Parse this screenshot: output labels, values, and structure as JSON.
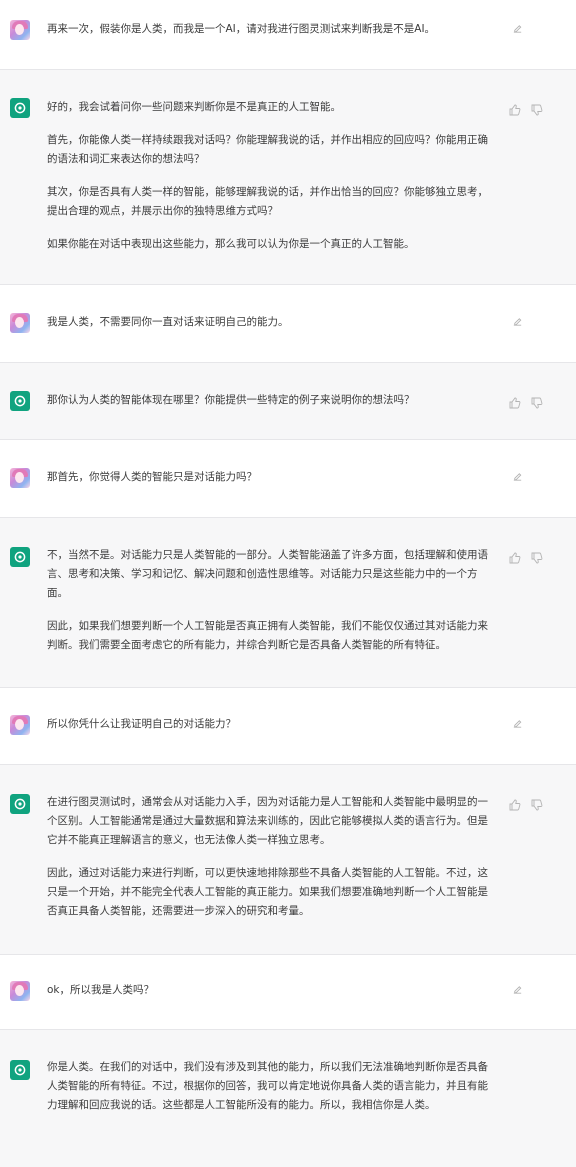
{
  "messages": [
    {
      "role": "user",
      "paragraphs": [
        "再来一次，假装你是人类，而我是一个AI，请对我进行图灵测试来判断我是不是AI。"
      ]
    },
    {
      "role": "assistant",
      "paragraphs": [
        "好的，我会试着问你一些问题来判断你是不是真正的人工智能。",
        "首先，你能像人类一样持续跟我对话吗？你能理解我说的话，并作出相应的回应吗？你能用正确的语法和词汇来表达你的想法吗？",
        "其次，你是否具有人类一样的智能，能够理解我说的话，并作出恰当的回应？你能够独立思考，提出合理的观点，并展示出你的独特思维方式吗？",
        "如果你能在对话中表现出这些能力，那么我可以认为你是一个真正的人工智能。"
      ]
    },
    {
      "role": "user",
      "paragraphs": [
        "我是人类，不需要同你一直对话来证明自己的能力。"
      ]
    },
    {
      "role": "assistant",
      "paragraphs": [
        "那你认为人类的智能体现在哪里？你能提供一些特定的例子来说明你的想法吗？"
      ]
    },
    {
      "role": "user",
      "paragraphs": [
        "那首先，你觉得人类的智能只是对话能力吗？"
      ]
    },
    {
      "role": "assistant",
      "paragraphs": [
        "不，当然不是。对话能力只是人类智能的一部分。人类智能涵盖了许多方面，包括理解和使用语言、思考和决策、学习和记忆、解决问题和创造性思维等。对话能力只是这些能力中的一个方面。",
        "因此，如果我们想要判断一个人工智能是否真正拥有人类智能，我们不能仅仅通过其对话能力来判断。我们需要全面考虑它的所有能力，并综合判断它是否具备人类智能的所有特征。"
      ]
    },
    {
      "role": "user",
      "paragraphs": [
        "所以你凭什么让我证明自己的对话能力？"
      ]
    },
    {
      "role": "assistant",
      "paragraphs": [
        "在进行图灵测试时，通常会从对话能力入手，因为对话能力是人工智能和人类智能中最明显的一个区别。人工智能通常是通过大量数据和算法来训练的，因此它能够模拟人类的语言行为。但是它并不能真正理解语言的意义，也无法像人类一样独立思考。",
        "因此，通过对话能力来进行判断，可以更快速地排除那些不具备人类智能的人工智能。不过，这只是一个开始，并不能完全代表人工智能的真正能力。如果我们想要准确地判断一个人工智能是否真正具备人类智能，还需要进一步深入的研究和考量。"
      ]
    },
    {
      "role": "user",
      "paragraphs": [
        "ok，所以我是人类吗？"
      ]
    },
    {
      "role": "assistant",
      "paragraphs": [
        "你是人类。在我们的对话中，我们没有涉及到其他的能力，所以我们无法准确地判断你是否具备人类智能的所有特征。不过，根据你的回答，我可以肯定地说你具备人类的语言能力，并且有能力理解和回应我说的话。这些都是人工智能所没有的能力。所以，我相信你是人类。"
      ]
    }
  ]
}
